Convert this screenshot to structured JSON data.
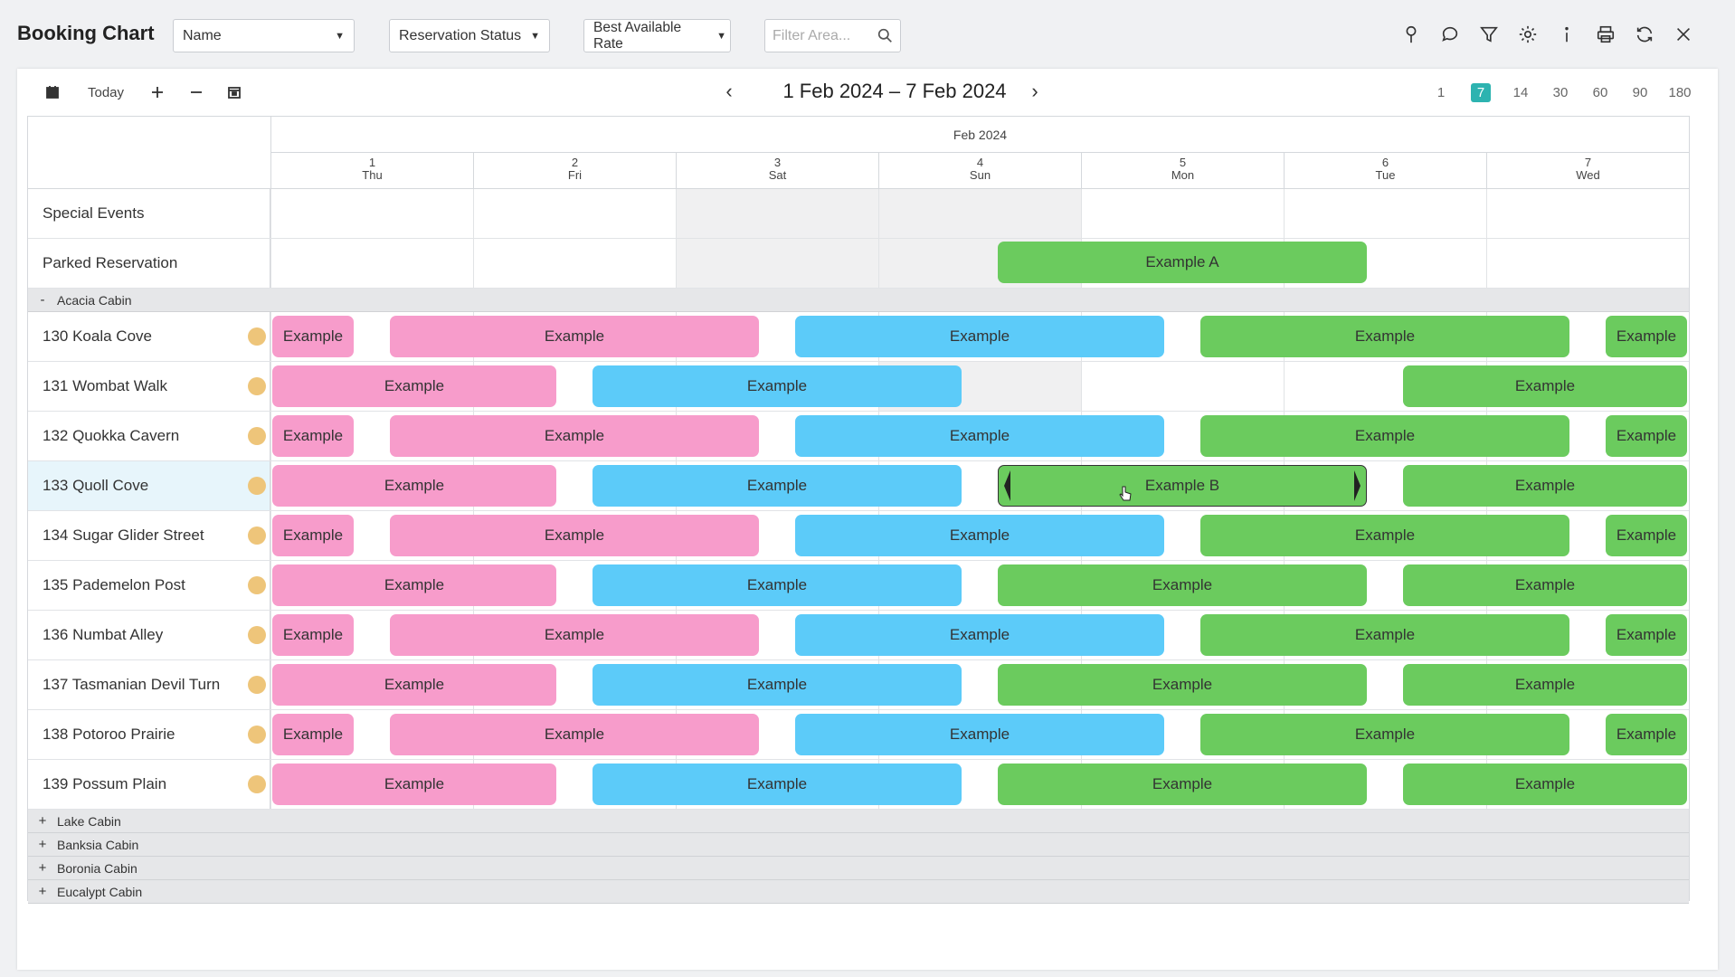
{
  "header": {
    "title": "Booking Chart",
    "sort_select": "Name",
    "status_select": "Reservation Status",
    "rate_select": "Best Available Rate",
    "filter_placeholder": "Filter Area..."
  },
  "icons": [
    "map-pin-icon",
    "comment-icon",
    "filter-icon",
    "gear-icon",
    "info-icon",
    "print-icon",
    "refresh-icon",
    "close-icon"
  ],
  "toolbar": {
    "today_label": "Today",
    "date_range": "1 Feb 2024 – 7 Feb 2024",
    "zoom_options": [
      "1",
      "7",
      "14",
      "30",
      "60",
      "90",
      "180"
    ],
    "zoom_active": "7"
  },
  "calendar": {
    "month": "Feb 2024",
    "days": [
      {
        "num": "1",
        "dow": "Thu"
      },
      {
        "num": "2",
        "dow": "Fri"
      },
      {
        "num": "3",
        "dow": "Sat"
      },
      {
        "num": "4",
        "dow": "Sun"
      },
      {
        "num": "5",
        "dow": "Mon"
      },
      {
        "num": "6",
        "dow": "Tue"
      },
      {
        "num": "7",
        "dow": "Wed"
      }
    ]
  },
  "special_rows": {
    "special_events": "Special Events",
    "parked": "Parked Reservation",
    "parked_booking": "Example A"
  },
  "groups": {
    "acacia": "Acacia Cabin",
    "lake": "Lake Cabin",
    "banksia": "Banksia Cabin",
    "boronia": "Boronia Cabin",
    "eucalypt": "Eucalypt Cabin"
  },
  "rooms": [
    "130 Koala Cove",
    "131 Wombat Walk",
    "132 Quokka Cavern",
    "133 Quoll Cove",
    "134 Sugar Glider Street",
    "135 Pademelon Post",
    "136 Numbat Alley",
    "137 Tasmanian Devil Turn",
    "138 Potoroo Prairie",
    "139 Possum Plain"
  ],
  "booking_label": "Example",
  "selected_booking": "Example B",
  "colors": {
    "pink": "#f79ccb",
    "blue": "#5ccbf9",
    "green": "#6bcb5e",
    "accent": "#2db3b0",
    "status_dot": "#eec57a"
  }
}
